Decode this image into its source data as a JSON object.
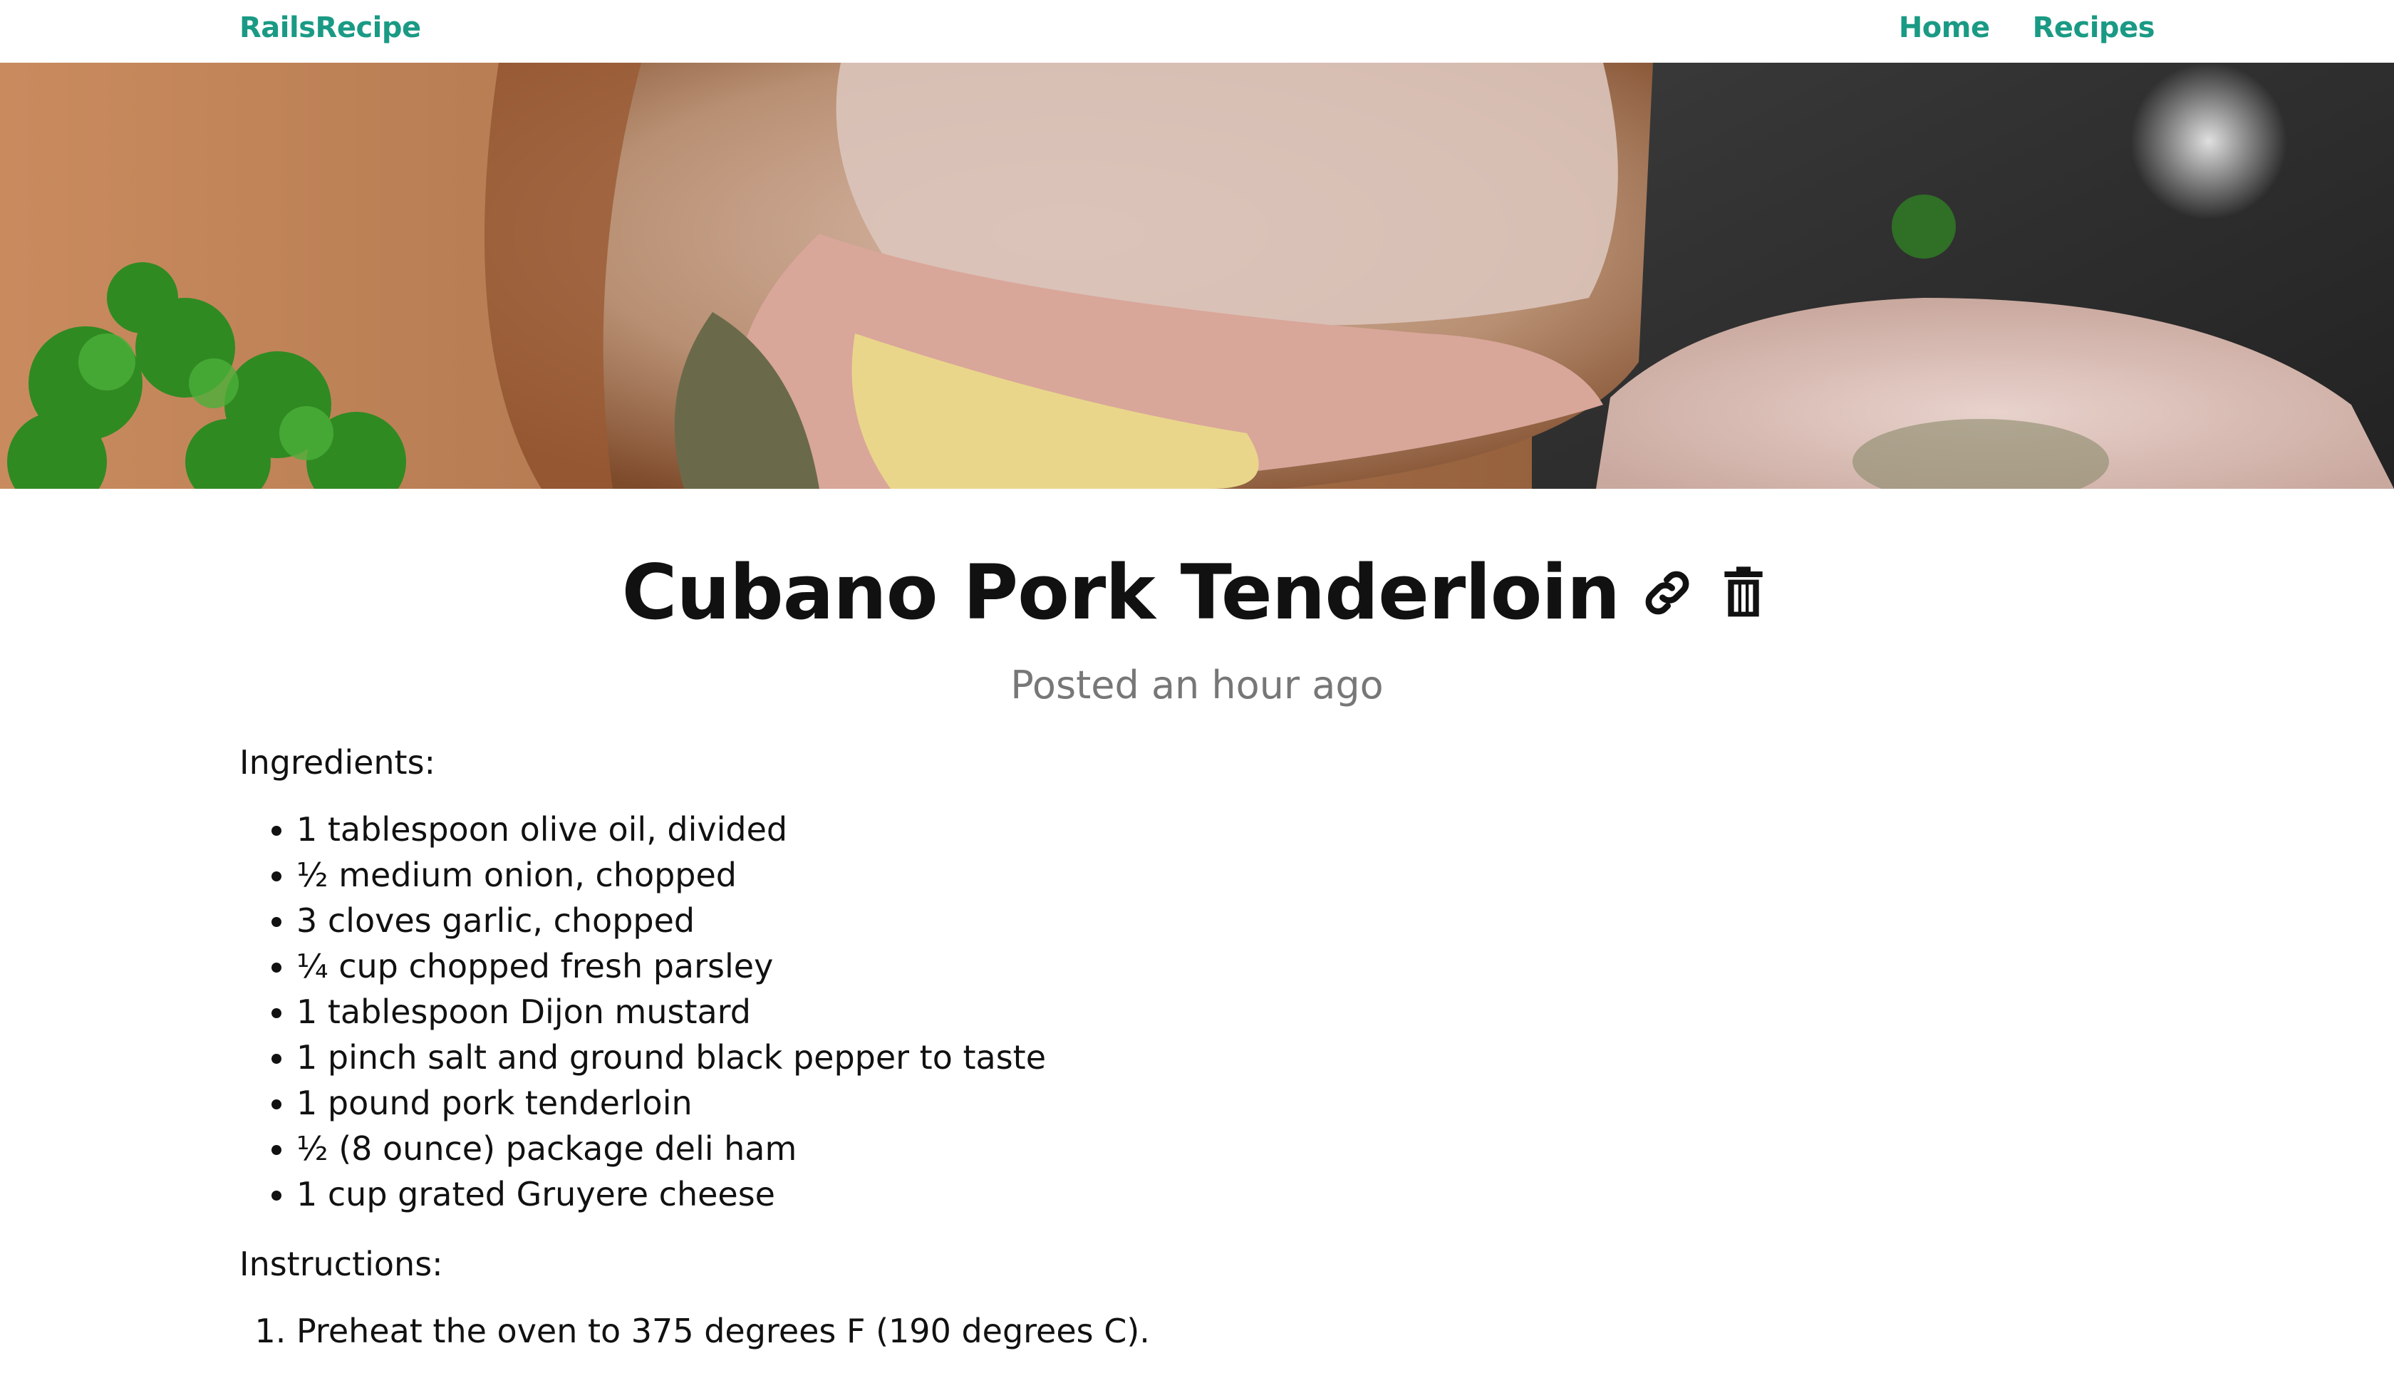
{
  "nav": {
    "brand": "RailsRecipe",
    "links": [
      "Home",
      "Recipes"
    ]
  },
  "hero": {
    "image": "stuffed pork tenderloin with parsley garnish"
  },
  "recipe": {
    "title": "Cubano Pork Tenderloin",
    "posted": "Posted an hour ago",
    "ingredients_label": "Ingredients:",
    "ingredients": [
      "1 tablespoon olive oil, divided",
      "½ medium onion, chopped",
      "3 cloves garlic, chopped",
      "¼ cup chopped fresh parsley",
      "1 tablespoon Dijon mustard",
      "1 pinch salt and ground black pepper to taste",
      "1 pound pork tenderloin",
      "½ (8 ounce) package deli ham",
      "1 cup grated Gruyere cheese"
    ],
    "instructions_label": "Instructions:",
    "instructions": [
      "Preheat the oven to 375 degrees F (190 degrees C)."
    ]
  },
  "icons": {
    "link": "link-icon",
    "delete": "trash-icon"
  },
  "colors": {
    "accent": "#1a9a84",
    "muted": "#777777",
    "text": "#111111"
  }
}
